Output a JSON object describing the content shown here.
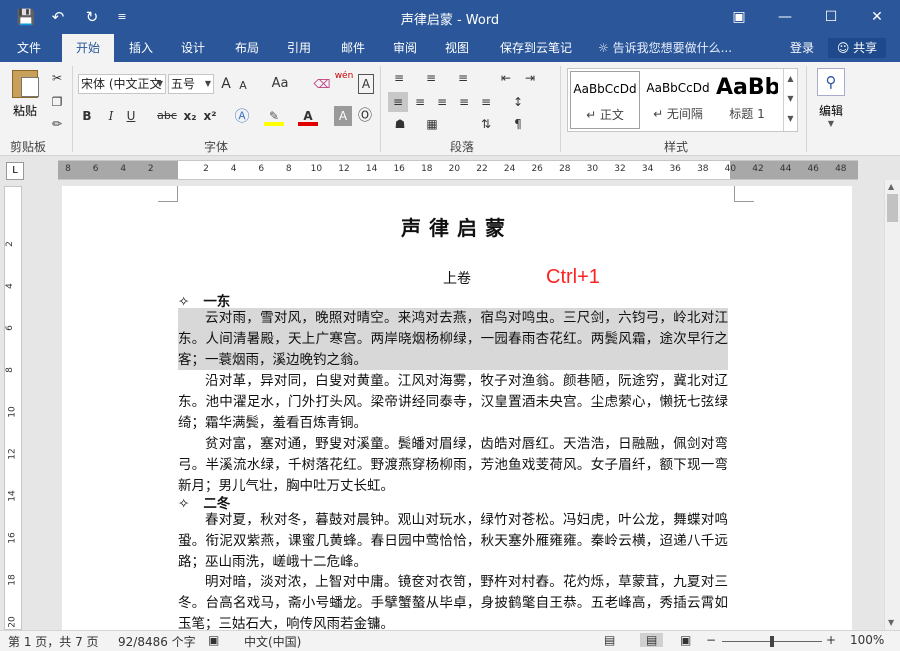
{
  "window": {
    "title": "声律启蒙 - Word"
  },
  "tabs": [
    "文件",
    "开始",
    "插入",
    "设计",
    "布局",
    "引用",
    "邮件",
    "审阅",
    "视图",
    "保存到云笔记"
  ],
  "tell_me": "告诉我您想要做什么...",
  "account": {
    "login": "登录",
    "share": "共享"
  },
  "ribbon": {
    "clipboard": {
      "paste": "粘贴",
      "label": "剪贴板"
    },
    "font": {
      "font_name": "宋体 (中文正文",
      "font_size": "五号",
      "label": "字体",
      "bold": "B",
      "italic": "I",
      "underline": "U",
      "strike": "abc",
      "subscript": "x₂",
      "superscript": "x²",
      "grow": "A",
      "shrink": "A",
      "case": "Aa",
      "pinyin": "wén",
      "border": "A"
    },
    "paragraph": {
      "label": "段落"
    },
    "styles": {
      "label": "样式",
      "items": [
        {
          "sample": "AaBbCcDd",
          "name": "↵ 正文"
        },
        {
          "sample": "AaBbCcDd",
          "name": "↵ 无间隔"
        },
        {
          "sample": "AaBb",
          "name": "标题 1"
        }
      ]
    },
    "edit": {
      "label": "编辑"
    }
  },
  "ruler": {
    "h": [
      "8",
      "6",
      "4",
      "2",
      "",
      "2",
      "4",
      "6",
      "8",
      "10",
      "12",
      "14",
      "16",
      "18",
      "20",
      "22",
      "24",
      "26",
      "28",
      "30",
      "32",
      "34",
      "36",
      "38",
      "40",
      "42",
      "44",
      "46",
      "48"
    ],
    "v": [
      "2",
      "4",
      "6",
      "8",
      "10",
      "12",
      "14",
      "16",
      "18",
      "20"
    ]
  },
  "document": {
    "title": "声律启蒙",
    "subtitle": "上卷",
    "hint": "Ctrl+1",
    "heading1": "一东",
    "para1": "云对雨，雪对风，晚照对晴空。来鸿对去燕，宿鸟对鸣虫。三尺剑，六钧弓，岭北对江东。人间清暑殿，天上广寒宫。两岸晓烟杨柳绿，一园春雨杏花红。两鬓风霜，途次早行之客；一蓑烟雨，溪边晚钓之翁。",
    "para2": "沿对革，异对同，白叟对黄童。江风对海雾，牧子对渔翁。颜巷陋，阮途穷，冀北对辽东。池中濯足水，门外打头风。梁帝讲经同泰寺，汉皇置酒未央宫。尘虑萦心，懒抚七弦绿绮；霜华满鬓，羞看百炼青铜。",
    "para3": "贫对富，塞对通，野叟对溪童。鬓皤对眉绿，齿皓对唇红。天浩浩，日融融，佩剑对弯弓。半溪流水绿，千树落花红。野渡燕穿杨柳雨，芳池鱼戏芰荷风。女子眉纤，额下现一弯新月；男儿气壮，胸中吐万丈长虹。",
    "heading2": "二冬",
    "para4": "春对夏，秋对冬，暮鼓对晨钟。观山对玩水，绿竹对苍松。冯妇虎，叶公龙，舞蝶对鸣蛩。衔泥双紫燕，课蜜几黄蜂。春日园中莺恰恰，秋天塞外雁雍雍。秦岭云横，迢递八千远路；巫山雨洗，嵯峨十二危峰。",
    "para5": "明对暗，淡对浓，上智对中庸。镜奁对衣笥，野杵对村舂。花灼烁，草蒙茸，九夏对三冬。台高名戏马，斋小号蟠龙。手擘蟹螯从毕卓，身披鹤氅自王恭。五老峰高，秀插云霄如玉笔；三姑石大，响传风雨若金镛。"
  },
  "status": {
    "page": "第 1 页，共 7 页",
    "words": "92/8486 个字",
    "lang": "中文(中国)",
    "zoom": "100%",
    "zoom_level": 1.0,
    "minus": "−",
    "plus": "+"
  },
  "colors": {
    "brand": "#2b579a",
    "hint_red": "#ff2222",
    "selection": "#d8d8d8"
  }
}
